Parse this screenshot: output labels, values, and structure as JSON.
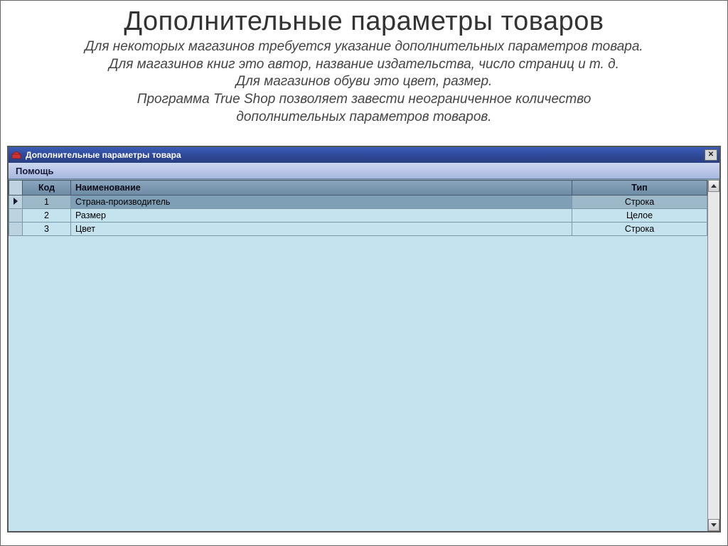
{
  "heading": "Дополнительные параметры товаров",
  "subtext_lines": {
    "l1": "Для некоторых магазинов требуется указание дополнительных параметров товара.",
    "l2": "Для магазинов книг это автор, название издательства, число страниц и т. д.",
    "l3": "Для магазинов обуви это цвет, размер.",
    "l4": "Программа True Shop позволяет завести неограниченное количество",
    "l5": "дополнительных параметров товаров."
  },
  "window": {
    "title": "Дополнительные параметры товара",
    "menu": {
      "help": "Помощь"
    }
  },
  "grid": {
    "headers": {
      "code": "Код",
      "name": "Наименование",
      "type": "Тип"
    },
    "rows": [
      {
        "code": "1",
        "name": "Страна-производитель",
        "type": "Строка",
        "selected": true
      },
      {
        "code": "2",
        "name": "Размер",
        "type": "Целое",
        "selected": false
      },
      {
        "code": "3",
        "name": "Цвет",
        "type": "Строка",
        "selected": false
      }
    ]
  }
}
